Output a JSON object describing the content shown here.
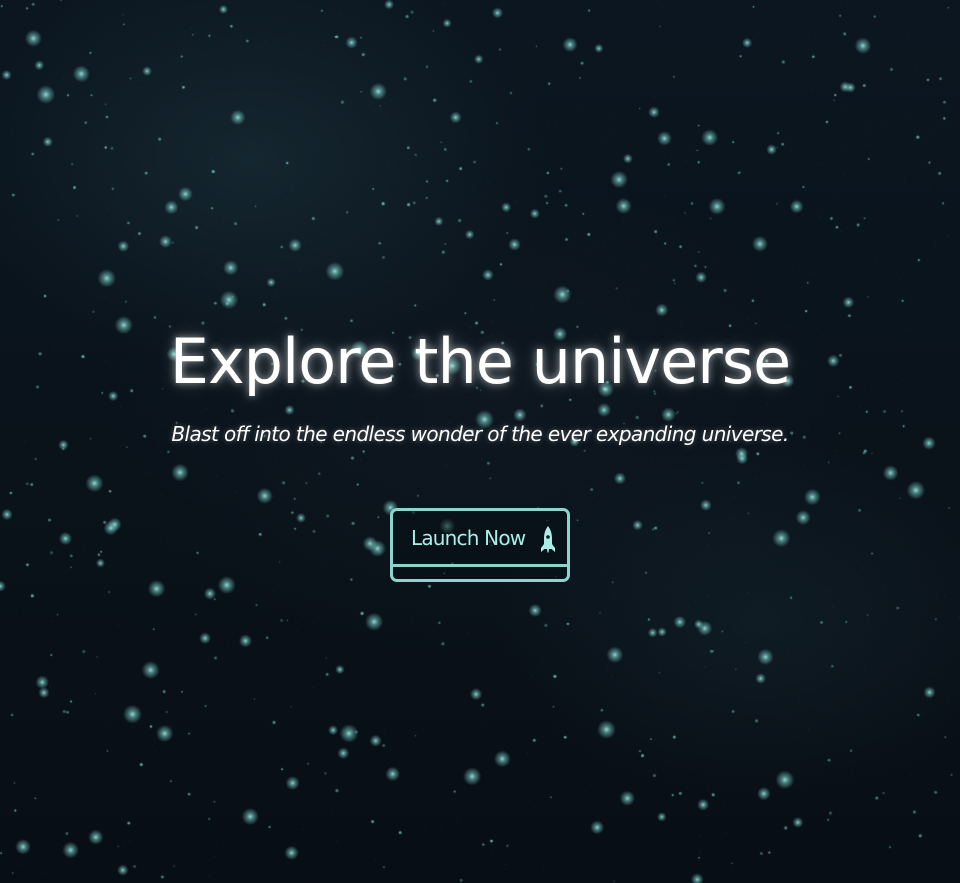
{
  "hero": {
    "title": "Explore the universe",
    "subtitle": "Blast off into the endless wonder of the ever expanding universe.",
    "cta_label": "Launch Now",
    "cta_icon": "rocket-icon"
  },
  "colors": {
    "background": "#0a131b",
    "title_text": "#ffffff",
    "accent": "#8fd3cf",
    "cta_text": "#a9efe8",
    "stars": "#7fd6cf"
  }
}
